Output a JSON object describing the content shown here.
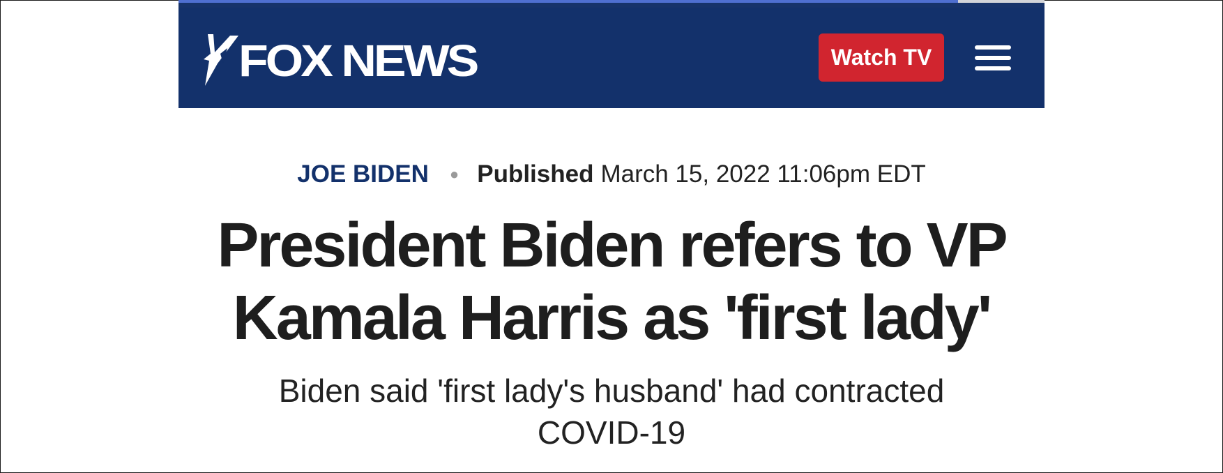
{
  "header": {
    "logo_text": "FOX NEWS",
    "watch_label": "Watch TV",
    "menu_icon": "hamburger-icon",
    "colors": {
      "navy": "#13316b",
      "red": "#d1252f"
    }
  },
  "article": {
    "category": "JOE BIDEN",
    "published_label": "Published",
    "published_date": "March 15, 2022 11:06pm EDT",
    "headline": "President Biden refers to VP Kamala Harris as 'first lady'",
    "subhead": "Biden said 'first lady's husband' had contracted COVID-19"
  }
}
